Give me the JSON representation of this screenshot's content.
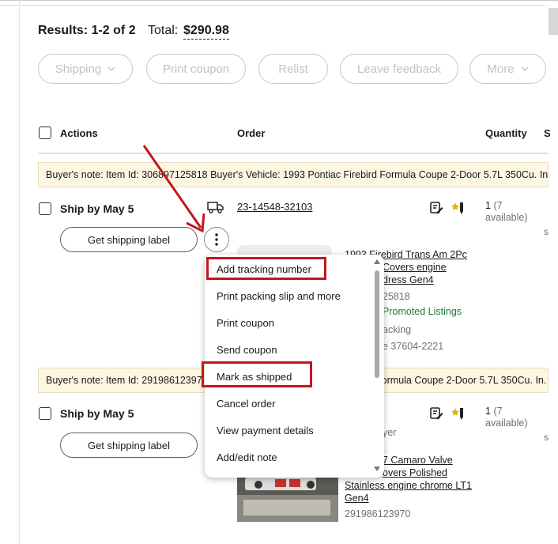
{
  "results": {
    "label": "Results: 1-2 of 2",
    "total_label": "Total:",
    "total_value": "$290.98"
  },
  "filters": [
    {
      "label": "Shipping",
      "has_chevron": true
    },
    {
      "label": "Print coupon"
    },
    {
      "label": "Relist"
    },
    {
      "label": "Leave feedback"
    },
    {
      "label": "More",
      "has_chevron": true
    }
  ],
  "table": {
    "headers": {
      "actions": "Actions",
      "order": "Order",
      "quantity": "Quantity",
      "extra": "S"
    }
  },
  "orders": [
    {
      "note": "Buyer's note: Item Id: 306897125818 Buyer's Vehicle: 1993 Pontiac Firebird Formula Coupe 2-Door 5.7L 350Cu. In.",
      "ship_by": "Ship by May 5",
      "label_button": "Get shipping label",
      "order_number": "23-14548-32103",
      "qty": "1",
      "qty_avail": "(7",
      "qty_avail2": "available)",
      "clipped": "s",
      "item_title_1": "1993 Firebird Trans Am 2Pc",
      "item_title_2": "Covers engine",
      "item_title_3": "dress Gen4",
      "item_id": "25818",
      "promo": "Promoted Listings",
      "tracking": "acking",
      "zip": "e 37604-2221"
    },
    {
      "note_left": "Buyer's note: Item Id: 29198612397",
      "note_right": "ormula Coupe 2-Door 5.7L 350Cu. In.",
      "ship_by": "Ship by May 5",
      "label_button": "Get shipping label",
      "qty": "1",
      "qty_avail": "(7",
      "qty_avail2": "available)",
      "clipped": "s",
      "buyer": "yer",
      "item_title_1": "7 Camaro Valve",
      "item_title_2": "overs Polished",
      "item_title_3": "Stainless engine chrome LT1",
      "item_title_4": "Gen4",
      "item_id": "291986123970"
    }
  ],
  "menu": {
    "items": [
      "Add tracking number",
      "Print packing slip and more",
      "Print coupon",
      "Send coupon",
      "Mark as shipped",
      "Cancel order",
      "View payment details",
      "Add/edit note"
    ]
  },
  "colors": {
    "annotation_red": "#c4161c",
    "promo_green": "#1d7a3a",
    "note_bg": "#fdf6e2"
  }
}
